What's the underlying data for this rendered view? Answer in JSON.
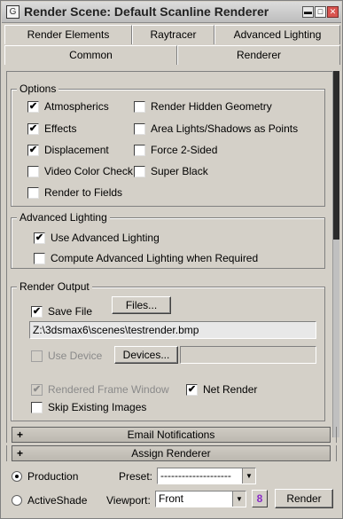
{
  "window": {
    "title": "Render Scene: Default Scanline Renderer",
    "controls": {
      "minimize": "▬",
      "maximize": "□",
      "close": "✕"
    }
  },
  "tabs": {
    "row1": [
      "Render Elements",
      "Raytracer",
      "Advanced Lighting"
    ],
    "row2": [
      "Common",
      "Renderer"
    ]
  },
  "options": {
    "legend": "Options",
    "atmospherics": {
      "label": "Atmospherics",
      "checked": true
    },
    "effects": {
      "label": "Effects",
      "checked": true
    },
    "displacement": {
      "label": "Displacement",
      "checked": true
    },
    "video_color_check": {
      "label": "Video Color Check",
      "checked": false
    },
    "render_to_fields": {
      "label": "Render to Fields",
      "checked": false
    },
    "render_hidden_geometry": {
      "label": "Render Hidden Geometry",
      "checked": false
    },
    "area_lights": {
      "label": "Area Lights/Shadows as Points",
      "checked": false
    },
    "force_2_sided": {
      "label": "Force 2-Sided",
      "checked": false
    },
    "super_black": {
      "label": "Super Black",
      "checked": false
    }
  },
  "advanced_lighting": {
    "legend": "Advanced Lighting",
    "use": {
      "label": "Use Advanced Lighting",
      "checked": true
    },
    "compute": {
      "label": "Compute Advanced Lighting when Required",
      "checked": false
    }
  },
  "render_output": {
    "legend": "Render Output",
    "save_file": {
      "label": "Save File",
      "checked": true
    },
    "files_button": "Files...",
    "path": "Z:\\3dsmax6\\scenes\\testrender.bmp",
    "use_device": {
      "label": "Use Device",
      "checked": false
    },
    "devices_button": "Devices...",
    "device_value": "",
    "rendered_frame_window": {
      "label": "Rendered Frame Window",
      "checked": true
    },
    "net_render": {
      "label": "Net Render",
      "checked": true
    },
    "skip_existing": {
      "label": "Skip Existing Images",
      "checked": false
    }
  },
  "rollouts": [
    {
      "sign": "+",
      "label": "Email Notifications"
    },
    {
      "sign": "+",
      "label": "Assign Renderer"
    }
  ],
  "bottom": {
    "production": {
      "label": "Production",
      "selected": true
    },
    "activeshade": {
      "label": "ActiveShade",
      "selected": false
    },
    "preset_label": "Preset:",
    "preset_value": "--------------------",
    "viewport_label": "Viewport:",
    "viewport_value": "Front",
    "lock_glyph": "8",
    "render_button": "Render"
  },
  "icons": {
    "app": "max-app-icon",
    "lock": "lock-icon",
    "dropdown": "chevron-down-icon"
  }
}
